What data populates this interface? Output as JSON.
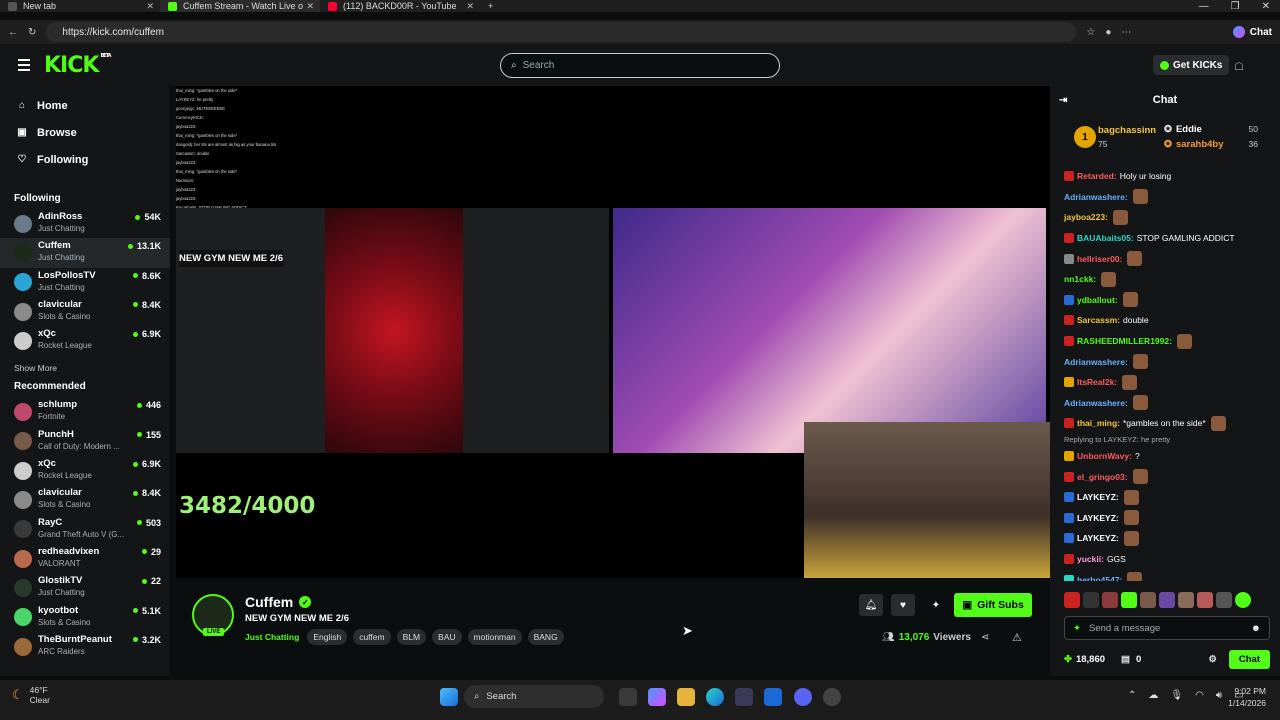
{
  "browser": {
    "tabs": [
      {
        "title": "New tab",
        "icon_color": "#555555",
        "active": false
      },
      {
        "title": "Cuffem Stream - Watch Live o",
        "icon_color": "#53fc18",
        "active": true
      },
      {
        "title": "(112) BACKD00R - YouTube",
        "icon_color": "#ff0033",
        "active": false
      }
    ],
    "url": "https://kick.com/cuffem",
    "chat_label": "Chat"
  },
  "header": {
    "logo": "KICK",
    "logo_badge": "BETA",
    "search_placeholder": "Search",
    "get_kicks": "Get KICKs"
  },
  "sidebar": {
    "nav": [
      {
        "label": "Home",
        "icon": "home-icon"
      },
      {
        "label": "Browse",
        "icon": "browse-icon"
      },
      {
        "label": "Following",
        "icon": "heart-icon"
      }
    ],
    "following_title": "Following",
    "following": [
      {
        "name": "AdinRoss",
        "category": "Just Chatting",
        "viewers": "54K",
        "color": "#6a7a8a"
      },
      {
        "name": "Cuffem",
        "category": "Just Chatting",
        "viewers": "13.1K",
        "color": "#1d2a1a"
      },
      {
        "name": "LosPollosTV",
        "category": "Just Chatting",
        "viewers": "8.6K",
        "color": "#2aa6d6"
      },
      {
        "name": "clavicular",
        "category": "Slots & Casino",
        "viewers": "8.4K",
        "color": "#8a8a8a"
      },
      {
        "name": "xQc",
        "category": "Rocket League",
        "viewers": "6.9K",
        "color": "#cccccc"
      }
    ],
    "show_more": "Show More",
    "recommended_title": "Recommended",
    "recommended": [
      {
        "name": "schlump",
        "category": "Fortnite",
        "viewers": "446",
        "color": "#c04a6a"
      },
      {
        "name": "PunchH",
        "category": "Call of Duty: Modern ...",
        "viewers": "155",
        "color": "#7a5a4a"
      },
      {
        "name": "xQc",
        "category": "Rocket League",
        "viewers": "6.9K",
        "color": "#cccccc"
      },
      {
        "name": "clavicular",
        "category": "Slots & Casino",
        "viewers": "8.4K",
        "color": "#8a8a8a"
      },
      {
        "name": "RayC",
        "category": "Grand Theft Auto V (G...",
        "viewers": "503",
        "color": "#3a3a3a"
      },
      {
        "name": "redheadvixen",
        "category": "VALORANT",
        "viewers": "29",
        "color": "#b86a4a"
      },
      {
        "name": "GlostikTV",
        "category": "Just Chatting",
        "viewers": "22",
        "color": "#2a3a2a"
      },
      {
        "name": "kyootbot",
        "category": "Slots & Casino",
        "viewers": "5.1K",
        "color": "#4ad66a"
      },
      {
        "name": "TheBurntPeanut",
        "category": "ARC Raiders",
        "viewers": "3.2K",
        "color": "#9a6a3a"
      }
    ]
  },
  "stream": {
    "overlay_chat": [
      "thai_ming: *gambles on the side*",
      "LAYKEYZ: he pretty",
      "georgeyjc: MUTEEEEEEE",
      "CurrencyKICK:",
      "jayboa223:",
      "thai_ming: *gambles on the side*",
      "dangeldj: her tits are almost as big as your banana tits",
      "Sarcassm: double",
      "jayboa223:",
      "thai_ming: *gambles on the side*",
      "Numnum:",
      "jayboa223:",
      "jayboa223:",
      "BAUAbaits: STOP GAMLING ADDICT",
      "thai_ming: *gambles on the side*",
      "dangeldj: her tits are almost as big as your banana tits",
      "ydballout:"
    ],
    "scene_tag": "NEW GYM NEW ME 2/6",
    "counter": "3482/4000"
  },
  "info": {
    "channel": "Cuffem",
    "title": "NEW GYM NEW ME 2/6",
    "category": "Just Chatting",
    "live": "LIVE",
    "tags": [
      "English",
      "cuffem",
      "BLM",
      "BAU",
      "motionman",
      "BANG"
    ],
    "gift": "Gift Subs",
    "viewers": "13,076",
    "viewers_label": "Viewers"
  },
  "chat": {
    "title": "Chat",
    "leaderboard": {
      "first": {
        "rank": "1",
        "name": "bagchassinn",
        "value": "75"
      },
      "second": {
        "name": "Eddie",
        "value": "50"
      },
      "third": {
        "name": "sarahb4by",
        "value": "36"
      }
    },
    "messages": [
      {
        "user": "Retarded:",
        "text": "Holy ur losing",
        "color": "#ff5a5a",
        "emote": false,
        "badge": "#cc2222"
      },
      {
        "user": "Adrianwashere:",
        "text": "",
        "color": "#6ab0ff",
        "emote": true,
        "badge": ""
      },
      {
        "user": "jayboa223:",
        "text": "",
        "color": "#f5c53c",
        "emote": true,
        "badge": ""
      },
      {
        "user": "BAUAbaits05:",
        "text": "STOP GAMLING ADDICT",
        "color": "#2ad6c6",
        "emote": false,
        "badge": "#cc2222"
      },
      {
        "user": "hellriser00:",
        "text": "",
        "color": "#ff5a5a",
        "emote": true,
        "badge": "#888888"
      },
      {
        "user": "nn1ckk:",
        "text": "",
        "color": "#53fc18",
        "emote": true,
        "badge": ""
      },
      {
        "user": "ydballout:",
        "text": "",
        "color": "#53fc18",
        "emote": true,
        "badge": "#2a6ad6"
      },
      {
        "user": "Sarcassm:",
        "text": "double",
        "color": "#f5c53c",
        "emote": false,
        "badge": "#cc2222"
      },
      {
        "user": "RASHEEDMILLER1992:",
        "text": "",
        "color": "#53fc18",
        "emote": true,
        "badge": "#cc2222"
      },
      {
        "user": "Adrianwashere:",
        "text": "",
        "color": "#6ab0ff",
        "emote": true,
        "badge": ""
      },
      {
        "user": "ItsReal2k:",
        "text": "",
        "color": "#ff5a5a",
        "emote": true,
        "badge": "#e5a500"
      },
      {
        "user": "Adrianwashere:",
        "text": "",
        "color": "#6ab0ff",
        "emote": true,
        "badge": ""
      },
      {
        "user": "thai_ming:",
        "text": "*gambles on the side*",
        "color": "#f5c53c",
        "emote": true,
        "badge": "#cc2222"
      }
    ],
    "reply": "Replying to LAYKEYZ: he pretty",
    "messages2": [
      {
        "user": "UnbornWavy:",
        "text": "?",
        "color": "#ff5a5a",
        "emote": false,
        "badge": "#e5a500"
      },
      {
        "user": "el_gringo03:",
        "text": "",
        "color": "#ff5a5a",
        "emote": true,
        "badge": "#cc2222"
      },
      {
        "user": "LAYKEYZ:",
        "text": "",
        "color": "#ffffff",
        "emote": true,
        "badge": "#2a6ad6"
      },
      {
        "user": "LAYKEYZ:",
        "text": "",
        "color": "#ffffff",
        "emote": true,
        "badge": "#2a6ad6"
      },
      {
        "user": "LAYKEYZ:",
        "text": "",
        "color": "#ffffff",
        "emote": true,
        "badge": "#2a6ad6"
      },
      {
        "user": "yuckii:",
        "text": "GGS",
        "color": "#ff9ad6",
        "emote": false,
        "badge": "#cc2222"
      },
      {
        "user": "herbo4547:",
        "text": "",
        "color": "#6ab0ff",
        "emote": true,
        "badge": "#2ad6c6"
      }
    ],
    "send_placeholder": "Send a message",
    "kicks": "18,860",
    "subs": "0",
    "chat_button": "Chat"
  },
  "taskbar": {
    "temp": "46°F",
    "weather": "Clear",
    "search": "Search",
    "time": "9:02 PM",
    "date": "1/14/2026"
  }
}
